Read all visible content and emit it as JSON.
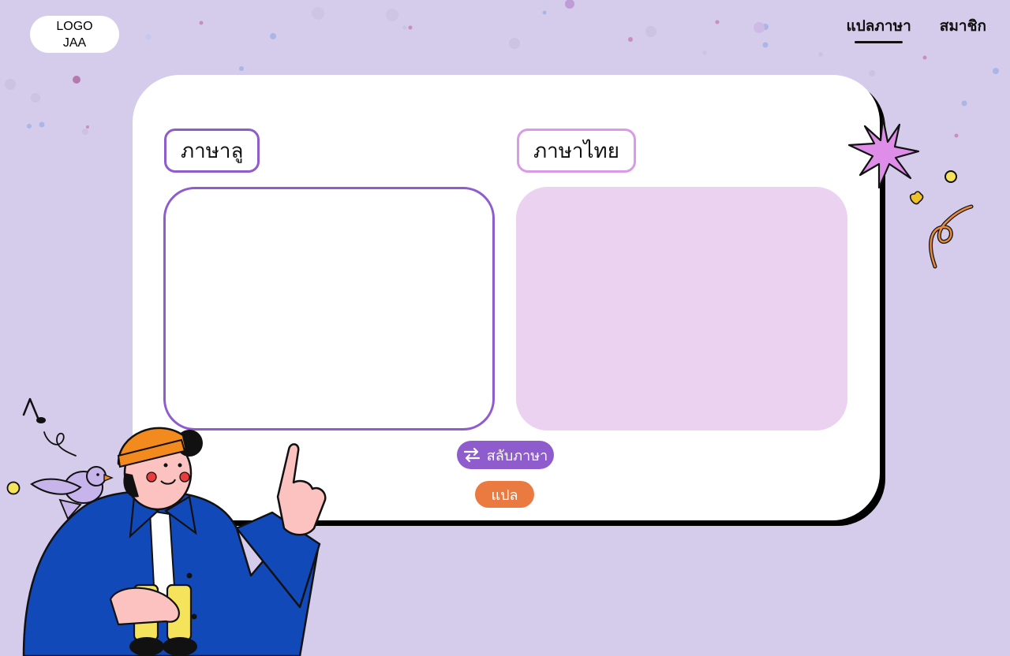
{
  "colors": {
    "background": "#d5cbeb",
    "primary_purple": "#8e5ccc",
    "light_pink": "#ecd2f1",
    "orange": "#ea7a40",
    "card": "#ffffff"
  },
  "logo": {
    "text": "LOGO\nJAA"
  },
  "nav": {
    "items": [
      {
        "label": "แปลภาษา",
        "active": true
      },
      {
        "label": "สมาชิก",
        "active": false
      }
    ]
  },
  "translator": {
    "source_label": "ภาษาลู",
    "target_label": "ภาษาไทย",
    "source_value": "",
    "target_value": "",
    "swap_button": {
      "label": "สลับภาษา",
      "icon": "swap-arrows-icon"
    },
    "translate_button": {
      "label": "แปล"
    }
  },
  "illustrations": [
    "person-pointing-illustration",
    "bird-illustration",
    "starburst-icon",
    "confetti-icon"
  ]
}
